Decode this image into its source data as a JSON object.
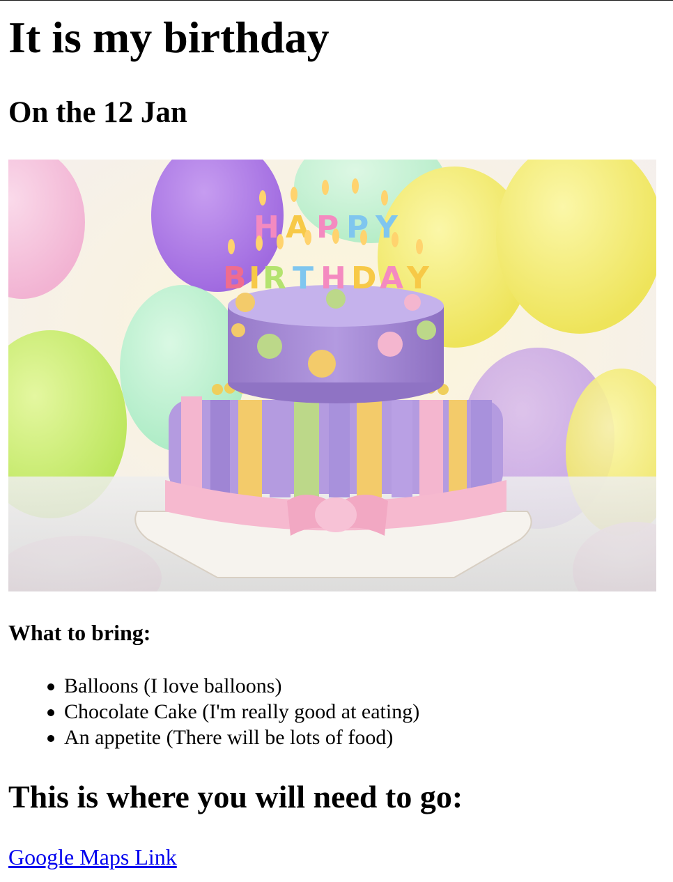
{
  "heading": "It is my birthday",
  "date_heading": "On the 12 Jan",
  "image": {
    "cake_text_top": "HAPPY",
    "cake_text_bottom": "BIRTHDAY",
    "colors": {
      "cake_purple": "#a88ad6",
      "stripe_pink": "#f4b6cf",
      "stripe_yellow": "#f3cb6a",
      "stripe_green": "#bcd889",
      "ribbon_pink": "#f6b9cf"
    }
  },
  "bring_heading": "What to bring:",
  "bring_items": [
    "Balloons (I love balloons)",
    "Chocolate Cake (I'm really good at eating)",
    "An appetite (There will be lots of food)"
  ],
  "location_heading": "This is where you will need to go:",
  "maps_link": {
    "label": "Google Maps Link",
    "color": "#0000ee"
  }
}
